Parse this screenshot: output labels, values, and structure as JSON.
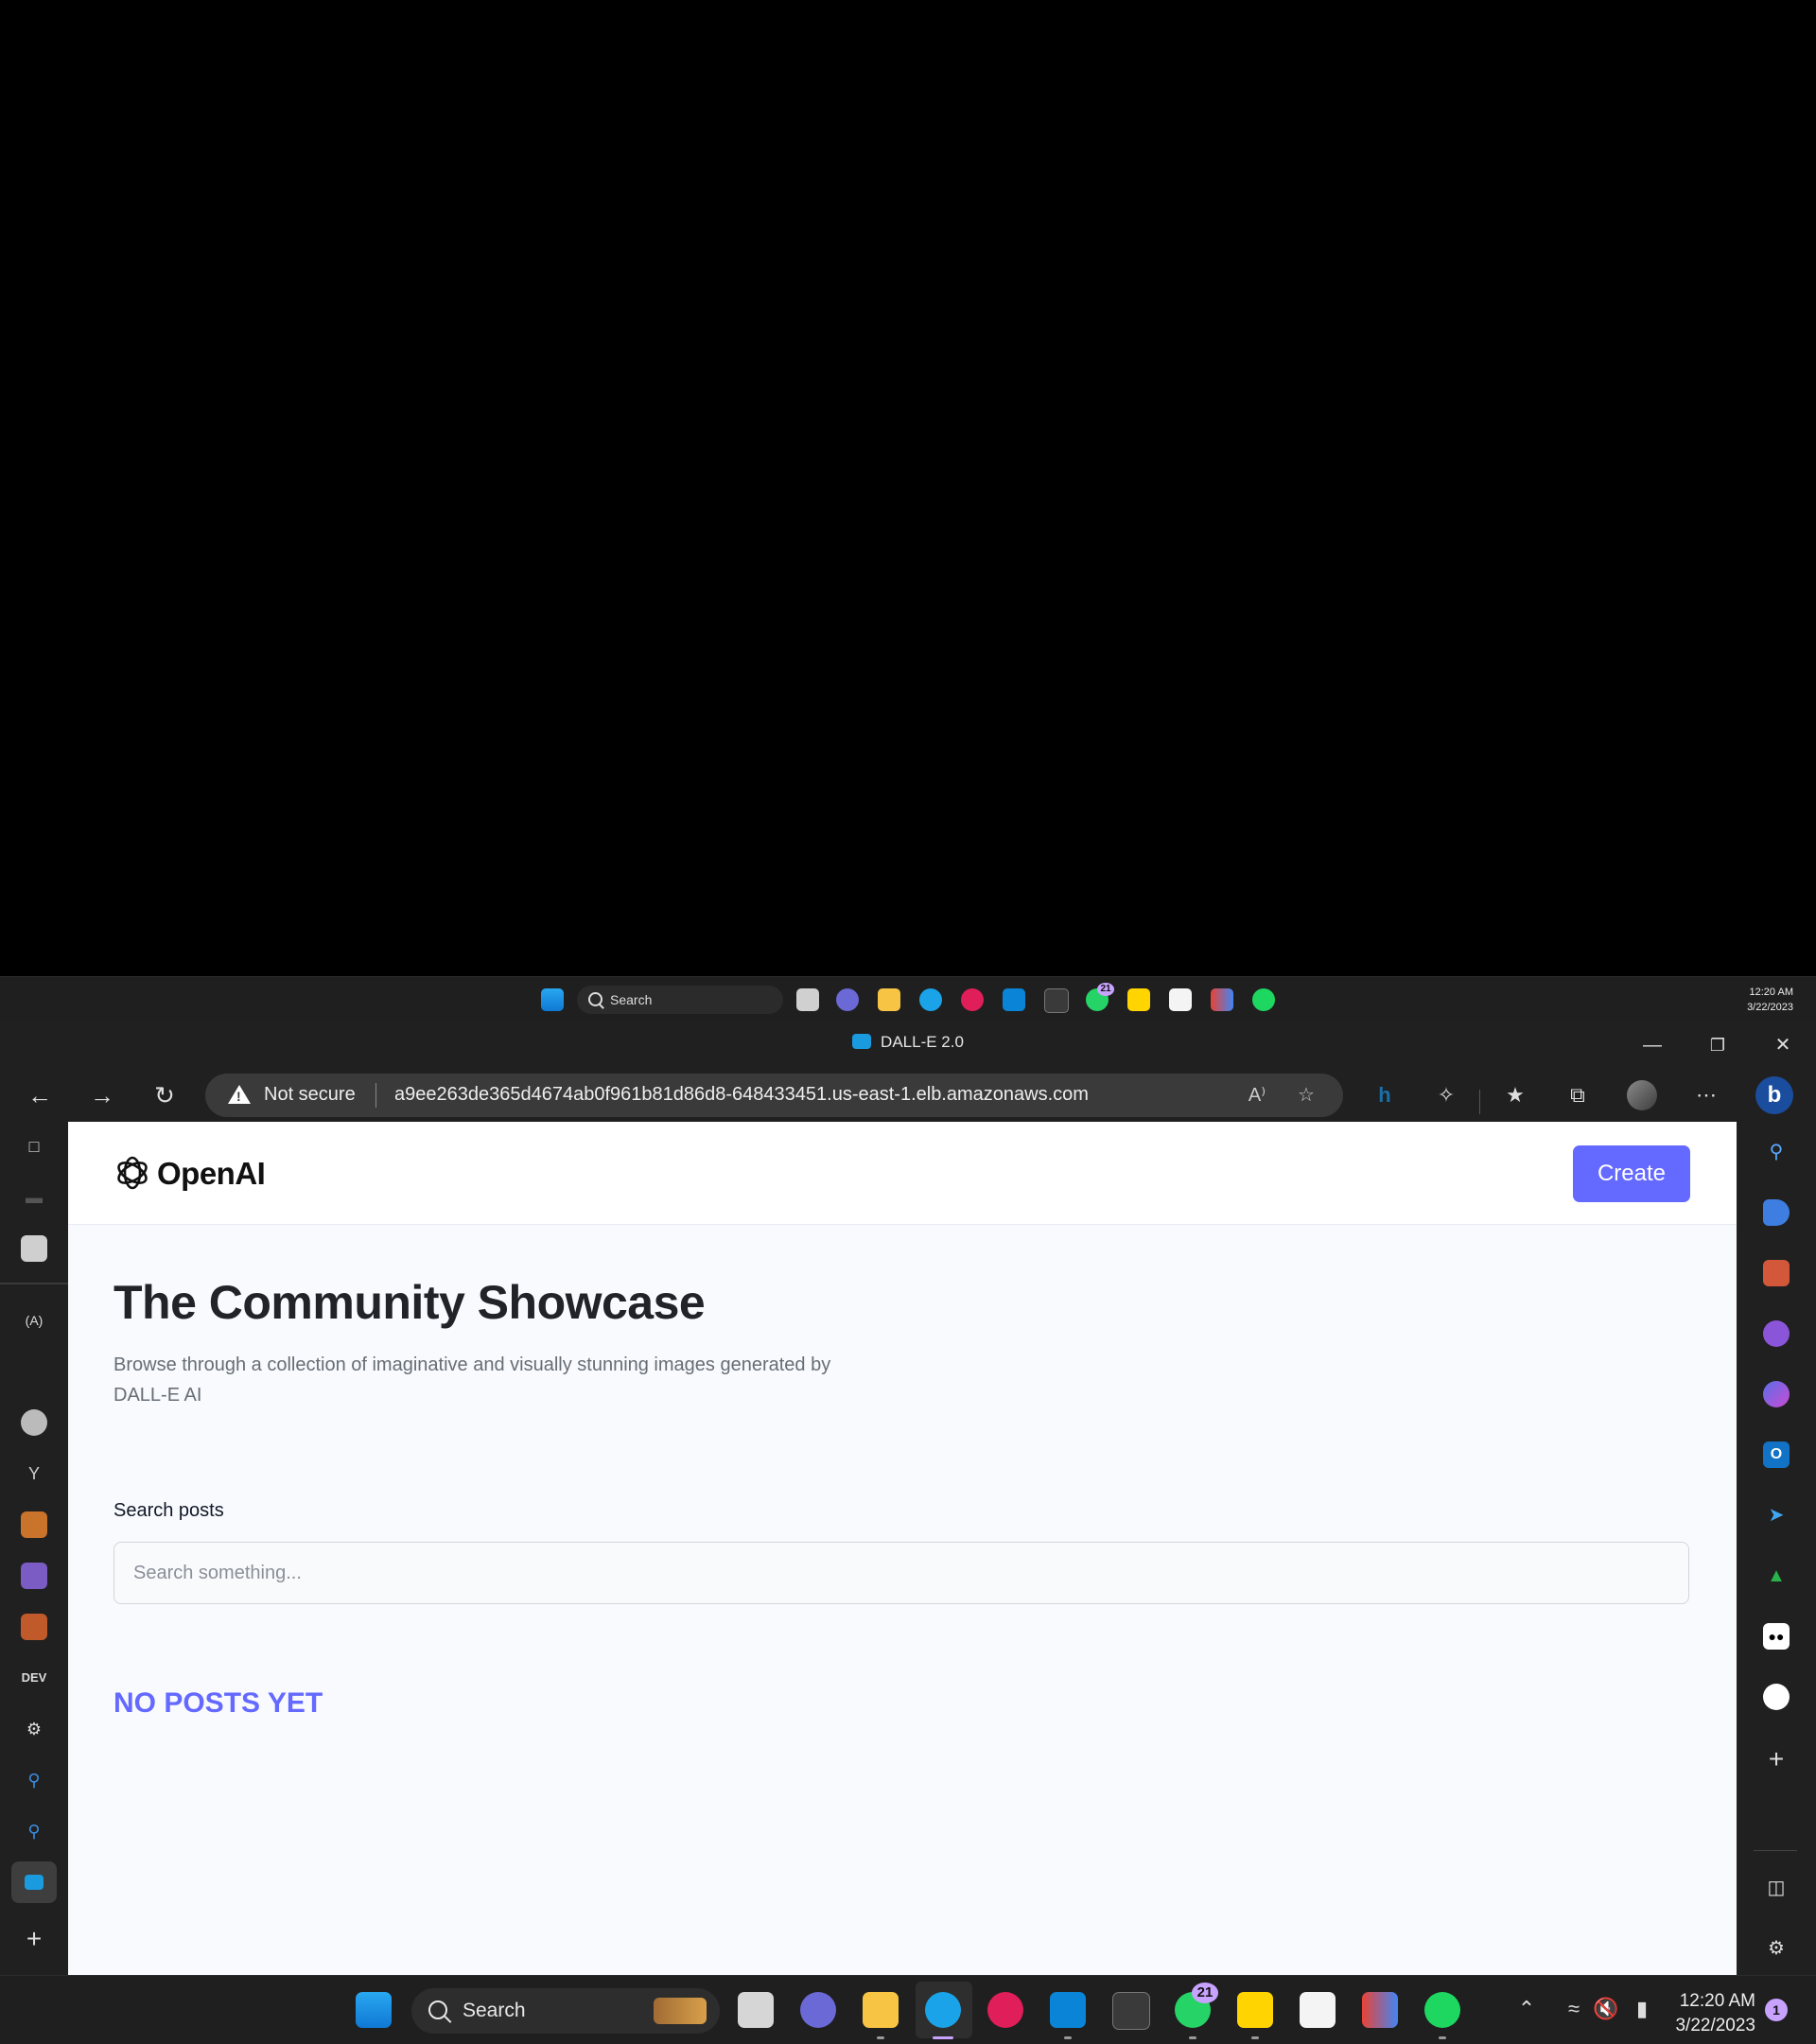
{
  "top_taskbar": {
    "search_label": "Search",
    "clock_time": "12:20 AM",
    "clock_date": "3/22/2023",
    "whatsapp_badge": "21"
  },
  "browser": {
    "tab_title": "DALL-E 2.0",
    "security_label": "Not secure",
    "url": "a9ee263de365d4674ab0f961b81d86d8-648433451.us-east-1.elb.amazonaws.com"
  },
  "page": {
    "logo_text": "OpenAI",
    "create_label": "Create",
    "title": "The Community Showcase",
    "subtitle": "Browse through a collection of imaginative and visually stunning images generated by DALL-E AI",
    "search_label": "Search posts",
    "search_placeholder": "Search something...",
    "empty_message": "NO POSTS YET"
  },
  "left_sidebar": {
    "dev_label": "DEV"
  },
  "bottom_taskbar": {
    "search_label": "Search",
    "clock_time": "12:20 AM",
    "clock_date": "3/22/2023",
    "whatsapp_badge": "21",
    "notification_count": "1"
  },
  "colors": {
    "accent": "#6469ff",
    "page_bg": "#f9fafe",
    "chrome_bg": "#202020"
  }
}
